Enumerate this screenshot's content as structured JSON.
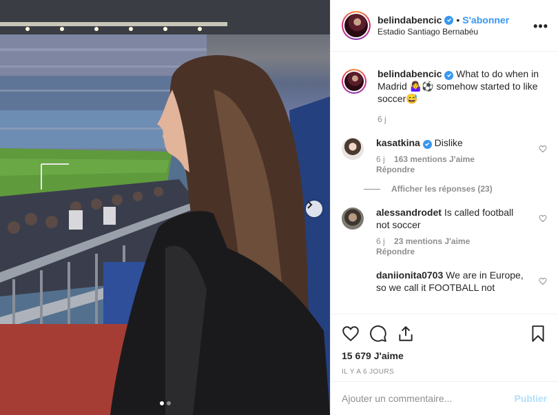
{
  "post": {
    "username": "belindabencic",
    "separator": "•",
    "follow_label": "S'abonner",
    "location": "Estadio Santiago Bernabéu",
    "more_icon": "more-horizontal-icon",
    "verified_color": "#3897f0",
    "caption": {
      "username": "belindabencic",
      "text": "What to do when in Madrid 🤷‍♀️⚽ somehow started to like soccer😅",
      "time": "6 j"
    },
    "carousel": {
      "slides": 2,
      "active_slide": 1
    }
  },
  "comments": [
    {
      "username": "kasatkina",
      "verified": true,
      "text": "Dislike",
      "time": "6 j",
      "likes": "163 mentions J'aime",
      "reply_label": "Répondre",
      "view_replies": "Afficher les réponses (23)"
    },
    {
      "username": "alessandrodet",
      "verified": false,
      "text": "Is called football not soccer",
      "time": "6 j",
      "likes": "23 mentions J'aime",
      "reply_label": "Répondre"
    },
    {
      "username": "daniionita0703",
      "verified": false,
      "text": "We are in Europe, so we call it FOOTBALL not"
    }
  ],
  "actions": {
    "likes_count": "15 679 J'aime",
    "timestamp": "IL Y A 6 JOURS"
  },
  "add_comment": {
    "placeholder": "Ajouter un commentaire...",
    "publish_label": "Publier"
  },
  "colors": {
    "link_blue": "#3897f0",
    "publish_disabled": "#b2dffc",
    "secondary_text": "#8e8e8e"
  }
}
